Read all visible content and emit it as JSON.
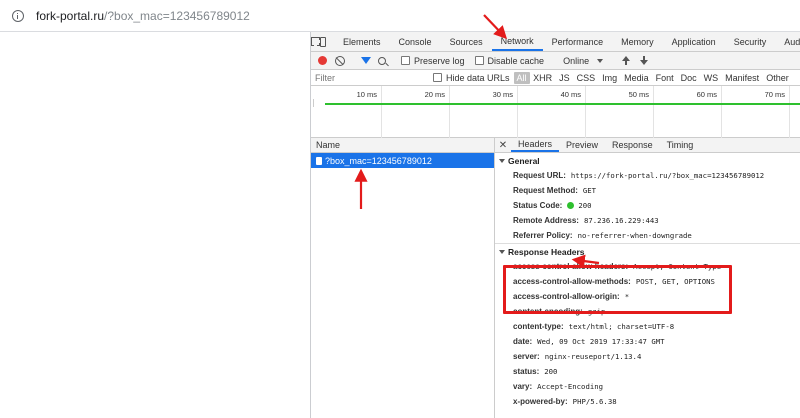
{
  "address_bar": {
    "host": "fork-portal.ru",
    "path": "/?box_mac=123456789012"
  },
  "devtools": {
    "tabs": [
      "Elements",
      "Console",
      "Sources",
      "Network",
      "Performance",
      "Memory",
      "Application",
      "Security",
      "Audits"
    ],
    "active_tab": "Network",
    "toolbar": {
      "preserve_log": "Preserve log",
      "disable_cache": "Disable cache",
      "throttling": "Online"
    },
    "filter": {
      "placeholder": "Filter",
      "hide_data_urls": "Hide data URLs",
      "types": [
        "All",
        "XHR",
        "JS",
        "CSS",
        "Img",
        "Media",
        "Font",
        "Doc",
        "WS",
        "Manifest",
        "Other"
      ],
      "active_type": "All"
    },
    "timeline_ticks": [
      "10 ms",
      "20 ms",
      "30 ms",
      "40 ms",
      "50 ms",
      "60 ms",
      "70 ms"
    ],
    "requests": {
      "header": "Name",
      "selected": "?box_mac=123456789012"
    },
    "details": {
      "tabs": [
        "Headers",
        "Preview",
        "Response",
        "Timing"
      ],
      "active_tab": "Headers",
      "general": {
        "title": "General",
        "rows": [
          {
            "key": "Request URL:",
            "value": "https://fork-portal.ru/?box_mac=123456789012"
          },
          {
            "key": "Request Method:",
            "value": "GET"
          },
          {
            "key": "Status Code:",
            "value": "200"
          },
          {
            "key": "Remote Address:",
            "value": "87.236.16.229:443"
          },
          {
            "key": "Referrer Policy:",
            "value": "no-referrer-when-downgrade"
          }
        ]
      },
      "response_headers": {
        "title": "Response Headers",
        "rows": [
          {
            "key": "access-control-allow-headers:",
            "value": "Accept, Content-Type"
          },
          {
            "key": "access-control-allow-methods:",
            "value": "POST, GET, OPTIONS"
          },
          {
            "key": "access-control-allow-origin:",
            "value": "*"
          },
          {
            "key": "content-encoding:",
            "value": "gzip"
          },
          {
            "key": "content-type:",
            "value": "text/html; charset=UTF-8"
          },
          {
            "key": "date:",
            "value": "Wed, 09 Oct 2019 17:33:47 GMT"
          },
          {
            "key": "server:",
            "value": "nginx-reuseport/1.13.4"
          },
          {
            "key": "status:",
            "value": "200"
          },
          {
            "key": "vary:",
            "value": "Accept-Encoding"
          },
          {
            "key": "x-powered-by:",
            "value": "PHP/5.6.38"
          }
        ]
      }
    }
  },
  "colors": {
    "accent": "#1a73e8",
    "annotation": "#e31b1b",
    "status_ok": "#2ec02e",
    "record": "#e53935"
  }
}
